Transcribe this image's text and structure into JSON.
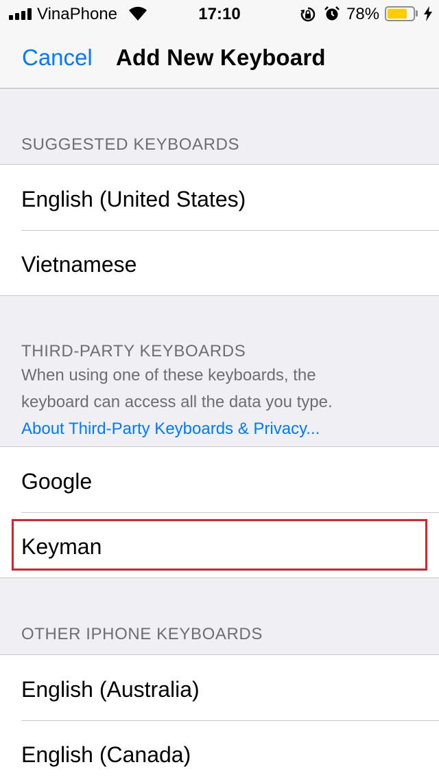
{
  "status_bar": {
    "carrier": "VinaPhone",
    "time": "17:10",
    "battery_percent_label": "78%",
    "battery_level": 0.78,
    "battery_color": "#ffcc00",
    "icons": [
      "signal-bars-icon",
      "wifi-icon",
      "rotation-lock-icon",
      "alarm-icon",
      "battery-icon",
      "charging-bolt-icon"
    ]
  },
  "nav_bar": {
    "cancel_label": "Cancel",
    "title": "Add New Keyboard"
  },
  "sections": {
    "suggested": {
      "header": "SUGGESTED KEYBOARDS",
      "items": [
        "English (United States)",
        "Vietnamese"
      ]
    },
    "third_party": {
      "header": "THIRD-PARTY KEYBOARDS",
      "footnote_line1": "When using one of these keyboards, the",
      "footnote_line2": "keyboard can access all the data you type.",
      "privacy_link": "About Third-Party Keyboards & Privacy...",
      "items": [
        "Google",
        "Keyman"
      ],
      "highlighted_item": "Keyman"
    },
    "other": {
      "header": "OTHER IPHONE KEYBOARDS",
      "items": [
        "English (Australia)",
        "English (Canada)"
      ]
    }
  },
  "colors": {
    "accent": "#007aff",
    "highlight": "#e0202a",
    "background": "#efeff4"
  }
}
